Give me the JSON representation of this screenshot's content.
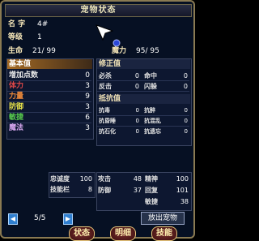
{
  "window": {
    "title": "宠物状态"
  },
  "name": {
    "label": "名 字",
    "value": "4#"
  },
  "level": {
    "label": "等级",
    "value": "1"
  },
  "hp": {
    "label": "生命",
    "value": "21/ 99"
  },
  "mp": {
    "label": "魔力",
    "value": "95/ 95"
  },
  "basic": {
    "title": "基本值",
    "rows": [
      {
        "label": "增加点数",
        "value": "0"
      },
      {
        "label": "体力",
        "value": "3"
      },
      {
        "label": "力量",
        "value": "9"
      },
      {
        "label": "防御",
        "value": "3"
      },
      {
        "label": "敏捷",
        "value": "6"
      },
      {
        "label": "魔法",
        "value": "3"
      }
    ]
  },
  "correct": {
    "title": "修正值",
    "rows": [
      {
        "a_label": "必杀",
        "a_value": "0",
        "b_label": "命中",
        "b_value": "0"
      },
      {
        "a_label": "反击",
        "a_value": "0",
        "b_label": "闪躲",
        "b_value": "0"
      }
    ]
  },
  "resist": {
    "title": "抵抗值",
    "rows": [
      {
        "a_label": "抗毒",
        "a_value": "0",
        "b_label": "抗醉",
        "b_value": "0"
      },
      {
        "a_label": "抗昏睡",
        "a_value": "0",
        "b_label": "抗混乱",
        "b_value": "0"
      },
      {
        "a_label": "抗石化",
        "a_value": "0",
        "b_label": "抗遗忘",
        "b_value": "0"
      }
    ]
  },
  "loyalty": {
    "label": "忠诚度",
    "value": "100"
  },
  "skill_slots": {
    "label": "技能栏",
    "value": "8"
  },
  "combat": {
    "attack": {
      "label": "攻击",
      "value": "48"
    },
    "mental": {
      "label": "精神",
      "value": "100"
    },
    "defense": {
      "label": "防御",
      "value": "37"
    },
    "recovery": {
      "label": "回复",
      "value": "101"
    },
    "agility": {
      "label": "敏捷",
      "value": "38"
    }
  },
  "pager": {
    "text": "5/5"
  },
  "release_button": "放出宠物",
  "tabs": [
    "状态",
    "明细",
    "技能"
  ]
}
